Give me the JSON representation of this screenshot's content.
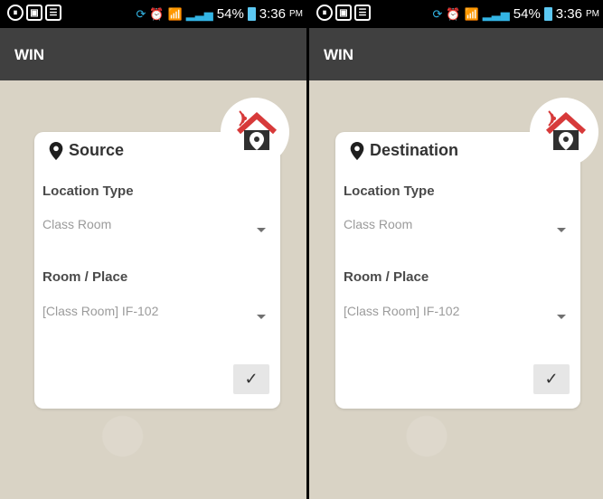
{
  "statusbar": {
    "battery_percent": "54%",
    "time": "3:36",
    "time_suffix": "PM"
  },
  "screens": [
    {
      "app_title": "WIN",
      "card_title": "Source",
      "location_type_label": "Location Type",
      "location_type_value": "Class Room",
      "room_label": "Room / Place",
      "room_value": "[Class Room] IF-102",
      "confirm_icon": "check-icon"
    },
    {
      "app_title": "WIN",
      "card_title": "Destination",
      "location_type_label": "Location Type",
      "location_type_value": "Class Room",
      "room_label": "Room / Place",
      "room_value": "[Class Room] IF-102",
      "confirm_icon": "check-icon"
    }
  ],
  "colors": {
    "actionbar": "#404040",
    "wallpaper": "#d9d3c5",
    "house_roof": "#d73a3a",
    "house_body": "#2f2f2f",
    "signal": "#33b5e5",
    "battery": "#5cc8f2"
  },
  "icons": {
    "location_pin": "map-pin-icon",
    "home_signal": "home-location-icon",
    "dropdown": "caret-down-icon"
  }
}
